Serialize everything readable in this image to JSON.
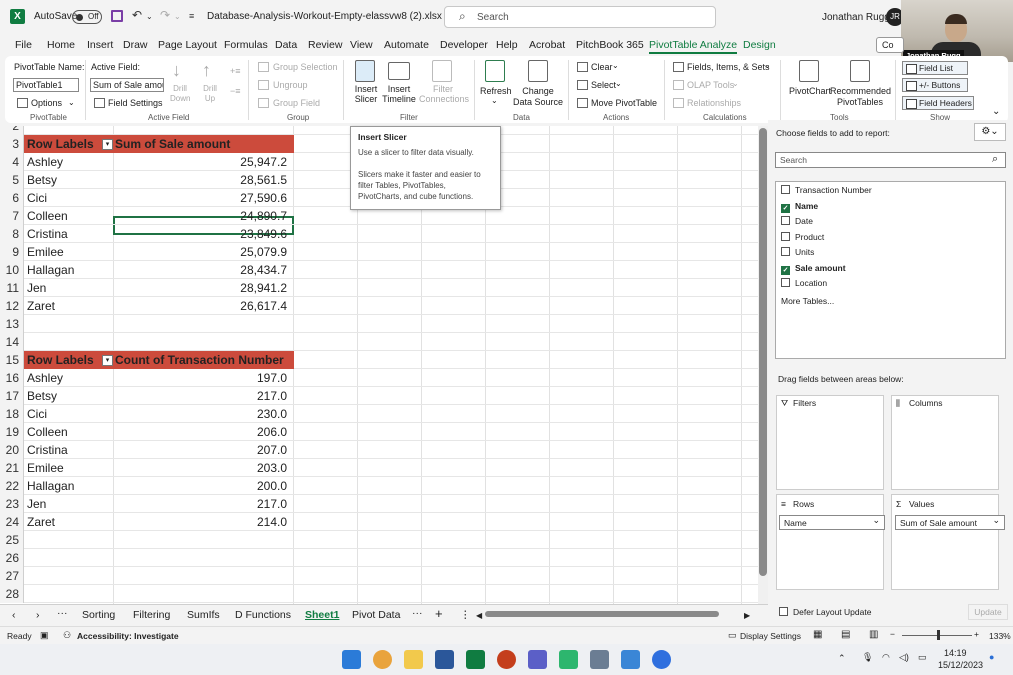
{
  "titlebar": {
    "app_icon": "X",
    "autosave_label": "AutoSave",
    "autosave_state": "Off",
    "filename": "Database-Analysis-Workout-Empty-elassvw8 (2).xlsx  -  E...",
    "search_placeholder": "Search",
    "user_name": "Jonathan Rugg",
    "avatar_initials": "JR",
    "webcam_name": "Jonathan Rugg"
  },
  "menu": {
    "items": [
      "File",
      "Home",
      "Insert",
      "Draw",
      "Page Layout",
      "Formulas",
      "Data",
      "Review",
      "View",
      "Automate",
      "Developer",
      "Help",
      "Acrobat",
      "PitchBook 365",
      "PivotTable Analyze",
      "Design"
    ],
    "active": "PivotTable Analyze",
    "comment_label": "Co"
  },
  "ribbon": {
    "pivot_name_label": "PivotTable Name:",
    "pivot_name_value": "PivotTable1",
    "options_label": "Options",
    "active_field_label": "Active Field:",
    "active_field_value": "Sum of Sale amount",
    "field_settings_label": "Field Settings",
    "drill_down_label": "Drill Down",
    "drill_up_label": "Drill Up",
    "group_selection_label": "Group Selection",
    "ungroup_label": "Ungroup",
    "group_field_label": "Group Field",
    "insert_slicer_label": "Insert Slicer",
    "insert_timeline_label": "Insert Timeline",
    "filter_connections_label": "Filter Connections",
    "refresh_label": "Refresh",
    "change_data_source_label": "Change Data Source",
    "clear_label": "Clear",
    "select_label": "Select",
    "move_pivot_label": "Move PivotTable",
    "fields_items_sets_label": "Fields, Items, & Sets",
    "olap_tools_label": "OLAP Tools",
    "relationships_label": "Relationships",
    "pivotchart_label": "PivotChart",
    "recommended_label": "Recommended PivotTables",
    "field_list_label": "Field List",
    "buttons_label": "+/- Buttons",
    "field_headers_label": "Field Headers",
    "groups": {
      "pivottable": "PivotTable",
      "active_field": "Active Field",
      "group": "Group",
      "filter": "Filter",
      "data": "Data",
      "actions": "Actions",
      "calculations": "Calculations",
      "tools": "Tools",
      "show": "Show"
    }
  },
  "tooltip": {
    "title": "Insert Slicer",
    "line1": "Use a slicer to filter data visually.",
    "line2": "Slicers make it faster and easier to",
    "line3": "filter Tables, PivotTables,",
    "line4": "PivotCharts, and cube functions."
  },
  "sheet": {
    "row_numbers": [
      "2",
      "3",
      "4",
      "5",
      "6",
      "7",
      "8",
      "9",
      "10",
      "11",
      "12",
      "13",
      "14",
      "15",
      "16",
      "17",
      "18",
      "19",
      "20",
      "21",
      "22",
      "23",
      "24",
      "25",
      "26",
      "27",
      "28"
    ],
    "pivot1": {
      "header_label": "Row Labels",
      "header_value": "Sum of Sale amount",
      "rows": [
        {
          "name": "Ashley",
          "value": "25,947.2"
        },
        {
          "name": "Betsy",
          "value": "28,561.5"
        },
        {
          "name": "Cici",
          "value": "27,590.6"
        },
        {
          "name": "Colleen",
          "value": "24,890.7"
        },
        {
          "name": "Cristina",
          "value": "23,849.6"
        },
        {
          "name": "Emilee",
          "value": "25,079.9"
        },
        {
          "name": "Hallagan",
          "value": "28,434.7"
        },
        {
          "name": "Jen",
          "value": "28,941.2"
        },
        {
          "name": "Zaret",
          "value": "26,617.4"
        }
      ]
    },
    "pivot2": {
      "header_label": "Row Labels",
      "header_value": "Count of Transaction Number",
      "rows": [
        {
          "name": "Ashley",
          "value": "197.0"
        },
        {
          "name": "Betsy",
          "value": "217.0"
        },
        {
          "name": "Cici",
          "value": "230.0"
        },
        {
          "name": "Colleen",
          "value": "206.0"
        },
        {
          "name": "Cristina",
          "value": "207.0"
        },
        {
          "name": "Emilee",
          "value": "203.0"
        },
        {
          "name": "Hallagan",
          "value": "200.0"
        },
        {
          "name": "Jen",
          "value": "217.0"
        },
        {
          "name": "Zaret",
          "value": "214.0"
        }
      ]
    }
  },
  "tabs": {
    "items": [
      "Sorting",
      "Filtering",
      "SumIfs",
      "D Functions",
      "Sheet1",
      "Pivot Data"
    ],
    "active": "Sheet1"
  },
  "status": {
    "ready": "Ready",
    "accessibility": "Accessibility: Investigate",
    "display_settings": "Display Settings",
    "zoom": "133%"
  },
  "pane": {
    "choose_fields": "Choose fields to add to report:",
    "search_placeholder": "Search",
    "fields": [
      {
        "name": "Transaction Number",
        "checked": false
      },
      {
        "name": "Name",
        "checked": true
      },
      {
        "name": "Date",
        "checked": false
      },
      {
        "name": "Product",
        "checked": false
      },
      {
        "name": "Units",
        "checked": false
      },
      {
        "name": "Sale amount",
        "checked": true
      },
      {
        "name": "Location",
        "checked": false
      }
    ],
    "more_tables": "More Tables...",
    "drag_label": "Drag fields between areas below:",
    "filters_label": "Filters",
    "columns_label": "Columns",
    "rows_label": "Rows",
    "values_label": "Values",
    "rows_value": "Name",
    "values_value": "Sum of Sale amount",
    "defer_label": "Defer Layout Update",
    "update_label": "Update"
  },
  "taskbar": {
    "time": "14:19",
    "date": "15/12/2023"
  },
  "colors": {
    "excel_green": "#107c41",
    "pivot_header": "#cc4b3c",
    "selection": "#1f7244"
  }
}
